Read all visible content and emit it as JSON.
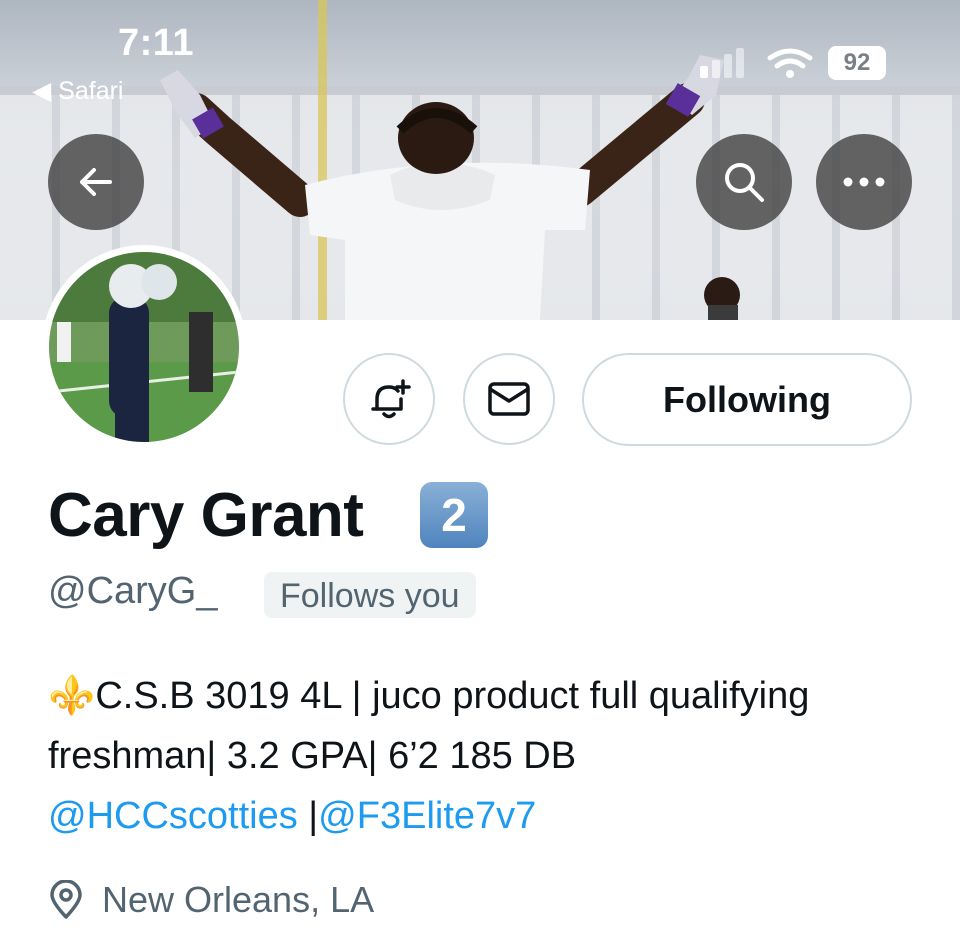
{
  "status_bar": {
    "time": "7:11",
    "back_app": "Safari",
    "battery": "92"
  },
  "header": {
    "back_icon": "arrow-left-icon",
    "search_icon": "search-icon",
    "more_icon": "more-horizontal-icon"
  },
  "actions": {
    "notify_icon": "bell-plus-icon",
    "message_icon": "envelope-icon",
    "following_label": "Following"
  },
  "profile": {
    "name": "Cary Grant",
    "badge": "2",
    "handle": "@CaryG_",
    "follows_you": "Follows you",
    "bio_emoji": "⚜️",
    "bio_text": "C.S.B 3019 4L | juco product full qualifying freshman| 3.2 GPA| 6’2 185 DB",
    "bio_link1": "@HCCscotties",
    "bio_separator": " |",
    "bio_link2": "@F3Elite7v7",
    "location": "New Orleans, LA"
  },
  "colors": {
    "link": "#1d9bf0",
    "muted": "#536471",
    "text": "#0f1419",
    "border": "#cfd9de"
  }
}
